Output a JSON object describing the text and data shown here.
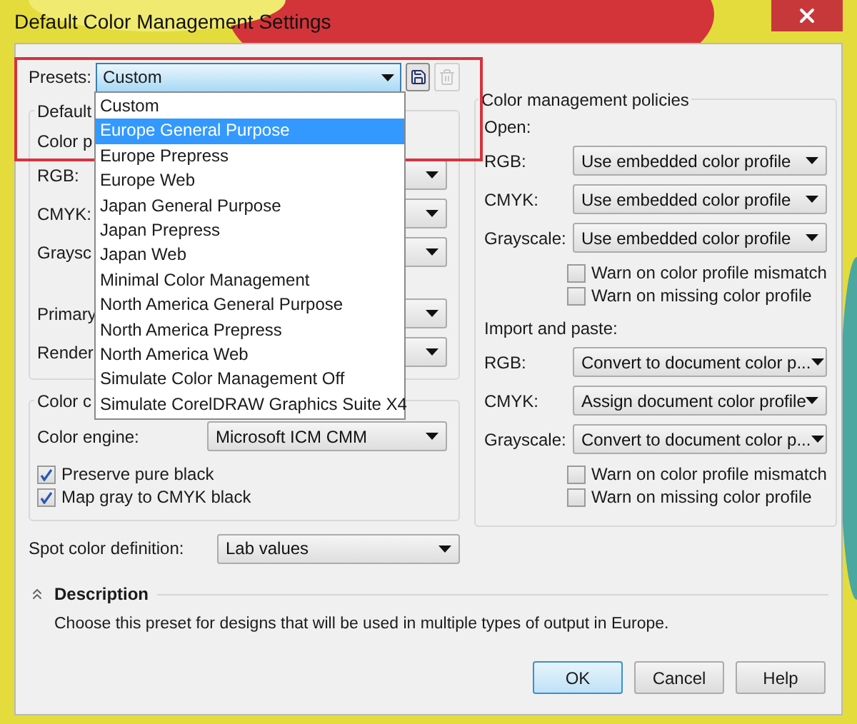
{
  "window": {
    "title": "Default Color Management Settings"
  },
  "presets": {
    "label": "Presets:",
    "value": "Custom",
    "delete_disabled": true
  },
  "preset_menu": [
    {
      "label": "Custom",
      "selected": false
    },
    {
      "label": "Europe General Purpose",
      "selected": true
    },
    {
      "label": "Europe Prepress",
      "selected": false
    },
    {
      "label": "Europe Web",
      "selected": false
    },
    {
      "label": "Japan General Purpose",
      "selected": false
    },
    {
      "label": "Japan Prepress",
      "selected": false
    },
    {
      "label": "Japan Web",
      "selected": false
    },
    {
      "label": "Minimal Color Management",
      "selected": false
    },
    {
      "label": "North America General Purpose",
      "selected": false
    },
    {
      "label": "North America Prepress",
      "selected": false
    },
    {
      "label": "North America Web",
      "selected": false
    },
    {
      "label": "Simulate Color Management Off",
      "selected": false
    },
    {
      "label": "Simulate CorelDRAW Graphics Suite X4",
      "selected": false
    }
  ],
  "default_group": {
    "title": "Default",
    "rows": [
      {
        "kind": "heading",
        "label": "Color p"
      },
      {
        "kind": "combo",
        "label": "RGB:"
      },
      {
        "kind": "combo",
        "label": "CMYK:"
      },
      {
        "kind": "combo",
        "label": "Graysc"
      },
      {
        "kind": "gap"
      },
      {
        "kind": "combo",
        "label": "Primary"
      },
      {
        "kind": "combo",
        "label": "Render"
      }
    ]
  },
  "conversion_group": {
    "title": "Color c",
    "engine_label": "Color engine:",
    "engine_value": "Microsoft ICM CMM",
    "checkboxes": [
      {
        "label": "Preserve pure black",
        "checked": true
      },
      {
        "label": "Map gray to CMYK black",
        "checked": true
      }
    ]
  },
  "spot": {
    "label": "Spot color definition:",
    "value": "Lab values"
  },
  "policies": {
    "title": "Color management policies",
    "sections": [
      {
        "label": "Open:",
        "rows": [
          {
            "label": "RGB:",
            "value": "Use embedded color profile"
          },
          {
            "label": "CMYK:",
            "value": "Use embedded color profile"
          },
          {
            "label": "Grayscale:",
            "value": "Use embedded color profile"
          }
        ],
        "checkboxes": [
          {
            "label": "Warn on color profile mismatch",
            "checked": false
          },
          {
            "label": "Warn on missing color profile",
            "checked": false
          }
        ]
      },
      {
        "label": "Import and paste:",
        "rows": [
          {
            "label": "RGB:",
            "value": "Convert to document color p..."
          },
          {
            "label": "CMYK:",
            "value": "Assign document color profile"
          },
          {
            "label": "Grayscale:",
            "value": "Convert to document color p..."
          }
        ],
        "checkboxes": [
          {
            "label": "Warn on color profile mismatch",
            "checked": false
          },
          {
            "label": "Warn on missing color profile",
            "checked": false
          }
        ]
      }
    ]
  },
  "description": {
    "title": "Description",
    "expanded": true,
    "text": "Choose this preset for designs that will be used in multiple types of output in Europe."
  },
  "buttons": [
    {
      "label": "OK",
      "default": true
    },
    {
      "label": "Cancel",
      "default": false
    },
    {
      "label": "Help",
      "default": false
    }
  ]
}
